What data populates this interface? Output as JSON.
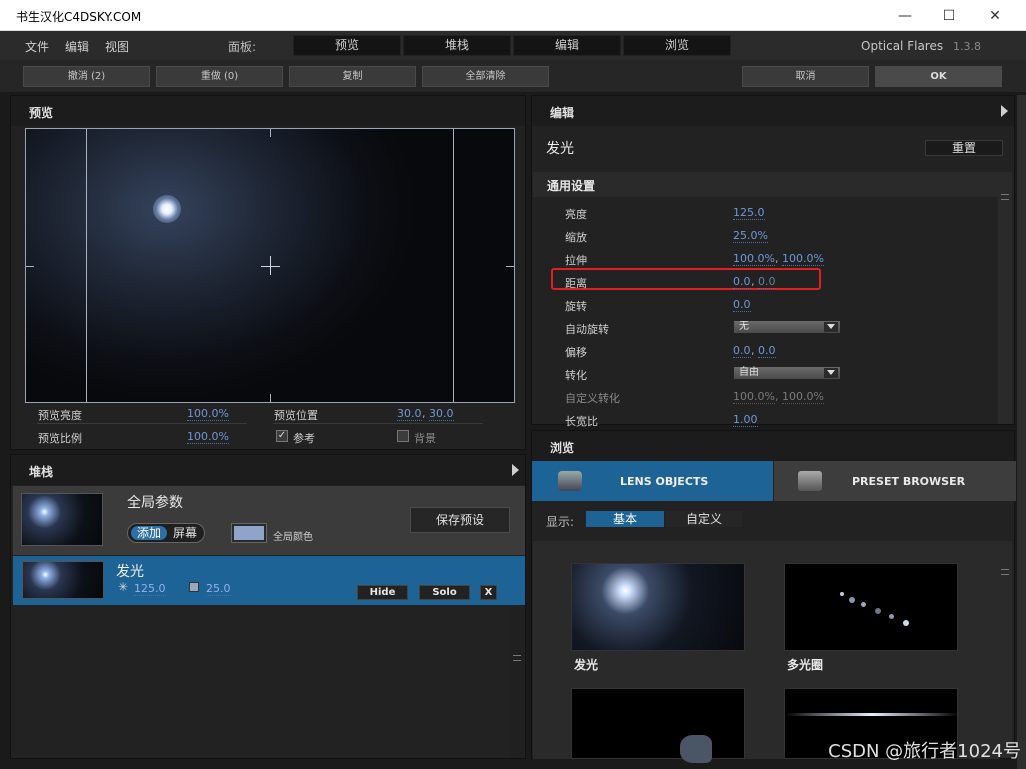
{
  "window": {
    "title": "书生汉化C4DSKY.COM",
    "minimize": "—",
    "maximize": "☐",
    "close": "✕"
  },
  "menu": {
    "file": "文件",
    "edit": "编辑",
    "view": "视图",
    "panel_label": "面板:",
    "panel_tabs": [
      "预览",
      "堆栈",
      "编辑",
      "浏览"
    ],
    "app_name": "Optical Flares",
    "version": "1.3.8"
  },
  "actions": {
    "undo": "撤消 (2)",
    "redo": "重做 (0)",
    "copy": "复制",
    "clear_all": "全部清除",
    "cancel": "取消",
    "ok": "OK"
  },
  "preview": {
    "title": "预览",
    "brightness_label": "预览亮度",
    "brightness": "100.0%",
    "ratio_label": "预览比例",
    "ratio": "100.0%",
    "position_label": "预览位置",
    "position_x": "30.0",
    "position_y": "30.0",
    "reference_label": "参考",
    "reference_checked": "✓",
    "background_label": "背景"
  },
  "stack": {
    "title": "堆栈",
    "global": {
      "name": "全局参数",
      "mode_on": "添加",
      "mode_off": "屏幕",
      "color_label": "全局颜色",
      "save_preset": "保存预设",
      "color": "#8fa4c8"
    },
    "layer": {
      "name": "发光",
      "brightness": "125.0",
      "scale": "25.0",
      "hide": "Hide",
      "solo": "Solo",
      "remove": "X"
    }
  },
  "edit": {
    "title": "编辑",
    "object_name": "发光",
    "reset": "重置",
    "section": "通用设置",
    "rows": [
      {
        "label": "亮度",
        "v1": "125.0"
      },
      {
        "label": "缩放",
        "v1": "25.0%"
      },
      {
        "label": "拉伸",
        "v1": "100.0%",
        "v2": "100.0%"
      },
      {
        "label": "距离",
        "v1": "0.0",
        "v2": "0.0"
      },
      {
        "label": "旋转",
        "v1": "0.0"
      },
      {
        "label": "自动旋转",
        "dropdown": "无"
      },
      {
        "label": "偏移",
        "v1": "0.0",
        "v2": "0.0"
      },
      {
        "label": "转化",
        "dropdown": "自由"
      },
      {
        "label": "自定义转化",
        "v1": "100.0%",
        "v2": "100.0%"
      },
      {
        "label": "长宽比",
        "v1": "1.00"
      }
    ]
  },
  "browse": {
    "title": "浏览",
    "tab_lens": "LENS OBJECTS",
    "tab_preset": "PRESET BROWSER",
    "show_label": "显示:",
    "filter_basic": "基本",
    "filter_custom": "自定义",
    "items": [
      {
        "name": "发光"
      },
      {
        "name": "多光圈"
      },
      {
        "name": ""
      },
      {
        "name": ""
      }
    ]
  },
  "watermark": "CSDN @旅行者1024号",
  "colors": {
    "accent": "#1e6396",
    "value": "#6f98d8",
    "highlight": "#e02020"
  }
}
